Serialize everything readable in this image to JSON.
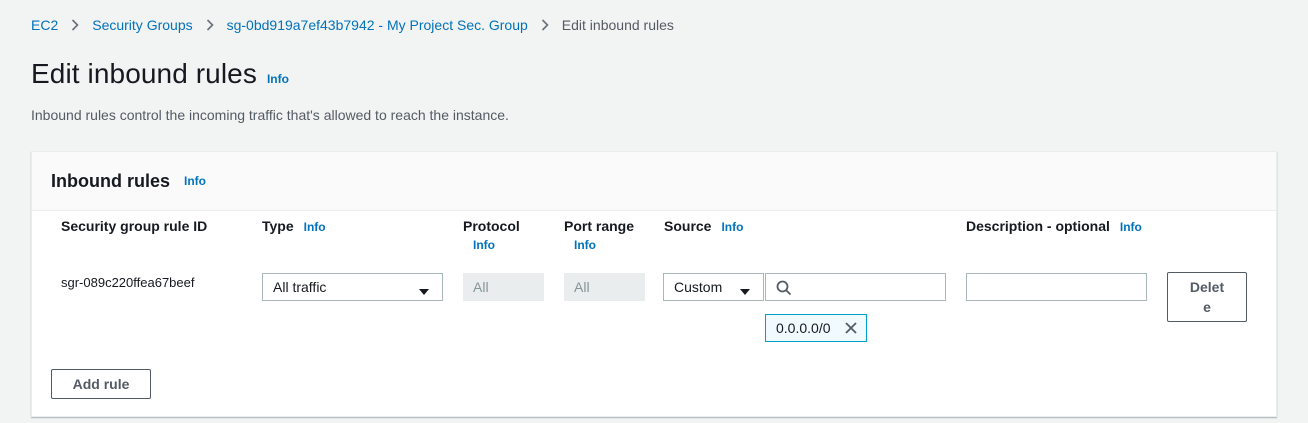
{
  "breadcrumb": {
    "items": [
      "EC2",
      "Security Groups",
      "sg-0bd919a7ef43b7942 - My Project Sec. Group",
      "Edit inbound rules"
    ]
  },
  "page": {
    "title": "Edit inbound rules",
    "info": "Info",
    "description": "Inbound rules control the incoming traffic that's allowed to reach the instance."
  },
  "panel": {
    "title": "Inbound rules",
    "info": "Info",
    "columns": {
      "rule_id": "Security group rule ID",
      "type": "Type",
      "protocol": "Protocol",
      "port_range": "Port range",
      "source": "Source",
      "description": "Description - optional",
      "info": "Info"
    },
    "rule": {
      "id": "sgr-089c220ffea67beef",
      "type": "All traffic",
      "protocol": "All",
      "port_range": "All",
      "source_type": "Custom",
      "search_value": "",
      "source_token": "0.0.0.0/0",
      "description_value": "",
      "delete_label_line1": "Delet",
      "delete_label_line2": "e"
    },
    "add_rule_label": "Add rule"
  },
  "colors": {
    "link": "#0073bb",
    "background": "#f2f3f3",
    "token_border": "#00a1c9"
  }
}
